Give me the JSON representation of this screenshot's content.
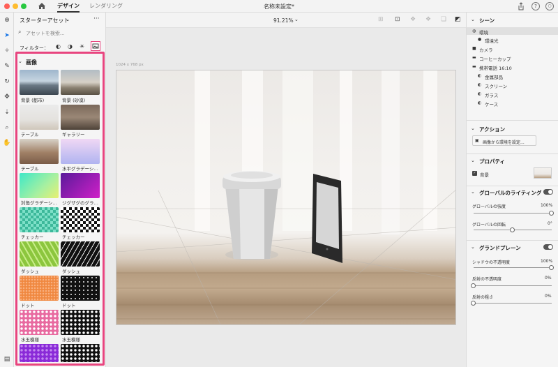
{
  "titlebar": {
    "tabs": [
      {
        "label": "デザイン"
      },
      {
        "label": "レンダリング"
      }
    ],
    "doc_title": "名称未設定*"
  },
  "options": {
    "zoom": "91.21%"
  },
  "canvas": {
    "size_label": "1024 x 768 px"
  },
  "assets": {
    "title": "スターターアセット",
    "search_placeholder": "アセットを検索...",
    "filter_label": "フィルター：",
    "section_title": "画像",
    "items": [
      {
        "label": "背景 (都市)"
      },
      {
        "label": "背景 (砂漠)"
      },
      {
        "label": "テーブル"
      },
      {
        "label": "ギャラリー"
      },
      {
        "label": "テーブル"
      },
      {
        "label": "水平グラデーシ…"
      },
      {
        "label": "対角グラデーシ…"
      },
      {
        "label": "ジグザグのグラ…"
      },
      {
        "label": "チェッカー"
      },
      {
        "label": "チェッカー"
      },
      {
        "label": "ダッシュ"
      },
      {
        "label": "ダッシュ"
      },
      {
        "label": "ドット"
      },
      {
        "label": "ドット"
      },
      {
        "label": "水玉模様"
      },
      {
        "label": "水玉模様"
      }
    ]
  },
  "scene": {
    "title": "シーン",
    "items": [
      {
        "label": "環境"
      },
      {
        "label": "環境光"
      },
      {
        "label": "カメラ"
      },
      {
        "label": "コーヒーカップ"
      },
      {
        "label": "携帯電話 16:10"
      },
      {
        "label": "金属部品"
      },
      {
        "label": "スクリーン"
      },
      {
        "label": "ガラス"
      },
      {
        "label": "ケース"
      }
    ]
  },
  "actions": {
    "title": "アクション",
    "button": "画像から環境を設定..."
  },
  "properties": {
    "title": "プロパティ",
    "background_label": "背景"
  },
  "global_lighting": {
    "title": "グローバルのライティング",
    "intensity_label": "グローバルの強度",
    "intensity_value": "100%",
    "intensity": 1.0,
    "rotation_label": "グローバルの回転",
    "rotation_value": "0°",
    "rotation": 0.5
  },
  "ground_plane": {
    "title": "グランドプレーン",
    "shadow_label": "シャドウの不透明度",
    "shadow_value": "100%",
    "shadow": 1.0,
    "reflect_opacity_label": "反射の不透明度",
    "reflect_opacity_value": "0%",
    "reflect_opacity": 0,
    "reflect_rough_label": "反射の粗さ",
    "reflect_rough_value": "0%",
    "reflect_rough": 0
  }
}
